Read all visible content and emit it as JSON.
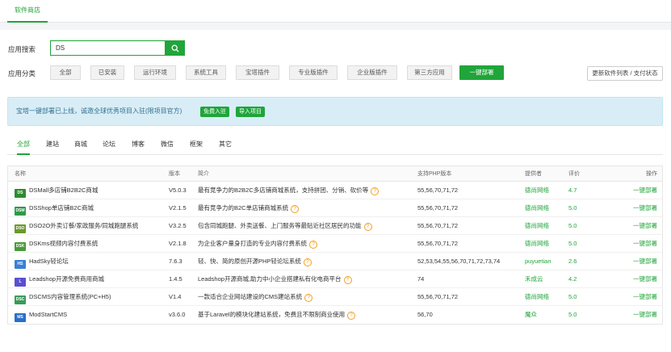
{
  "top_tab": {
    "label": "软件商店"
  },
  "search": {
    "label": "应用搜索",
    "value": "DS"
  },
  "category": {
    "label": "应用分类",
    "items": [
      "全部",
      "已安装",
      "运行环境",
      "系统工具",
      "宝塔插件",
      "专业版插件",
      "企业版插件",
      "第三方应用",
      "一键部署"
    ],
    "active_index": 8
  },
  "update_button": "更新软件列表 / 支付状态",
  "notice": {
    "text": "宝塔一键部署已上线，诚邀全球优秀项目入驻(限项目官方)",
    "btn1": "免费入驻",
    "btn2": "导入项目"
  },
  "subtabs": {
    "items": [
      "全部",
      "建站",
      "商城",
      "论坛",
      "博客",
      "微信",
      "框架",
      "其它"
    ],
    "active_index": 0
  },
  "table": {
    "headers": {
      "name": "名称",
      "version": "版本",
      "desc": "简介",
      "php": "支持PHP版本",
      "provider": "提供者",
      "score": "评价",
      "op": "操作"
    },
    "rows": [
      {
        "icon": "DS",
        "icon_color": "#2e8b2e",
        "name": "DSMall多店铺B2B2C商城",
        "version": "V5.0.3",
        "desc": "最有竞争力的B2B2C多店铺商城系统，支持拼团、分销、砍价等",
        "php": "55,56,70,71,72",
        "provider": "德尚网络",
        "score": "4.7",
        "op": "一键部署"
      },
      {
        "icon": "DSM",
        "icon_color": "#2e9a4a",
        "name": "DSShop单店铺B2C商城",
        "version": "V2.1.5",
        "desc": "最有竞争力的B2C单店铺商城系统",
        "php": "55,56,70,71,72",
        "provider": "德尚网络",
        "score": "5.0",
        "op": "一键部署"
      },
      {
        "icon": "DSO",
        "icon_color": "#6a9a2a",
        "name": "DSO2O外卖订餐/家政服务/同城跑腿系统",
        "version": "V3.2.5",
        "desc": "包含同城跑腿、外卖送餐、上门服务等最贴近社区居民的功能",
        "php": "55,56,70,71,72",
        "provider": "德尚网络",
        "score": "5.0",
        "op": "一键部署"
      },
      {
        "icon": "DSK",
        "icon_color": "#4a9a3a",
        "name": "DSKms视频内容付费系统",
        "version": "V2.1.8",
        "desc": "为企业客户量身打造的专业内容付费系统",
        "php": "55,56,70,71,72",
        "provider": "德尚网络",
        "score": "5.0",
        "op": "一键部署"
      },
      {
        "icon": "HS",
        "icon_color": "#3a7fd5",
        "name": "HadSky轻论坛",
        "version": "7.6.3",
        "desc": "轻、快、简的原创开源PHP轻论坛系统",
        "php": "52,53,54,55,56,70,71,72,73,74",
        "provider": "puyuetian",
        "score": "2.6",
        "op": "一键部署"
      },
      {
        "icon": "L",
        "icon_color": "#5a4fcf",
        "name": "Leadshop开源免费商用商城",
        "version": "1.4.5",
        "desc": "Leadshop开源商城,助力中小企业搭建私有化电商平台",
        "php": "74",
        "provider": "禾成云",
        "score": "4.2",
        "op": "一键部署"
      },
      {
        "icon": "DSC",
        "icon_color": "#3a9a5a",
        "name": "DSCMS内容管理系统(PC+H5)",
        "version": "V1.4",
        "desc": "一款适合企业网站建设的CMS建站系统",
        "php": "55,56,70,71,72",
        "provider": "德尚网络",
        "score": "5.0",
        "op": "一键部署"
      },
      {
        "icon": "MS",
        "icon_color": "#2a6fc9",
        "name": "ModStartCMS",
        "version": "v3.6.0",
        "desc": "基于Laravel的模块化建站系统，免费且不限制商业使用",
        "php": "56,70",
        "provider": "魔众",
        "score": "5.0",
        "op": "一键部署"
      }
    ]
  }
}
